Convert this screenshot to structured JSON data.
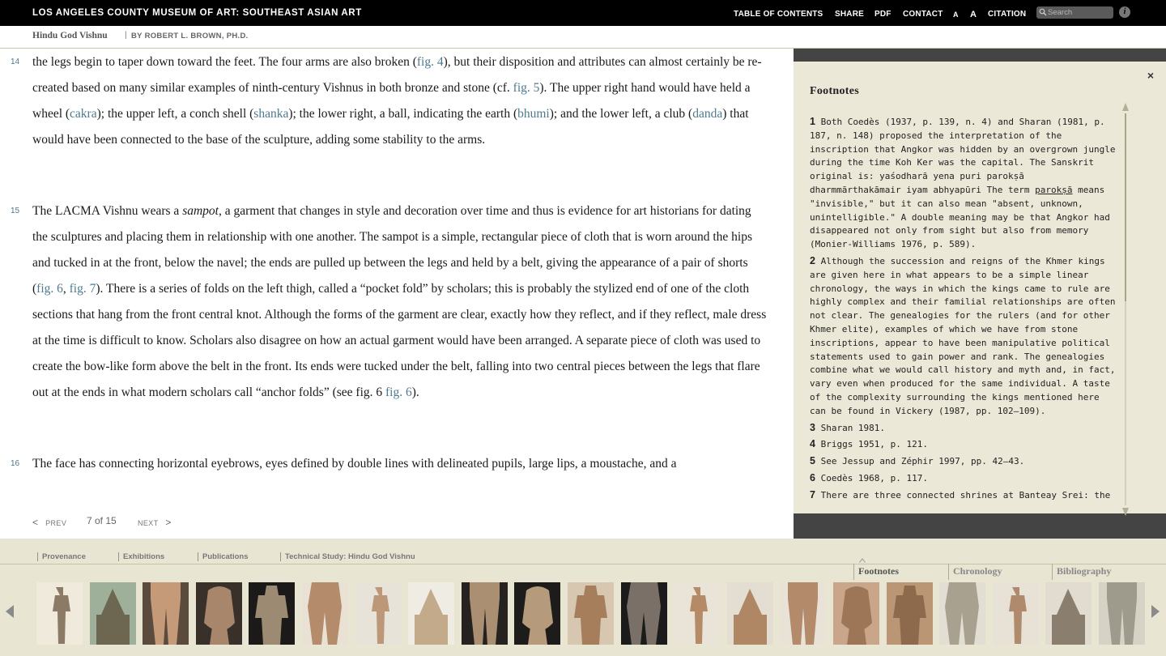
{
  "header": {
    "site_title": "LOS ANGELES COUNTY MUSEUM OF ART: SOUTHEAST ASIAN ART",
    "nav": [
      "TABLE OF CONTENTS",
      "SHARE",
      "PDF",
      "CONTACT",
      "A",
      "A",
      "CITATION"
    ],
    "search_placeholder": "Search",
    "info_label": "i"
  },
  "subheader": {
    "title": "Hindu God Vishnu",
    "separator": "|",
    "author": "BY ROBERT L. BROWN, PH.D."
  },
  "paragraphs": [
    {
      "number": "14",
      "t1": "the legs begin to taper down toward the feet. The four arms are also broken (",
      "a1": "fig. 4",
      "t2": "), but their disposition and attributes can almost certainly be re-created based on many similar examples of ninth-century Vishnus in both bronze and stone (cf. ",
      "a2": "fig. 5",
      "t3": "). The upper right hand would have held a wheel (",
      "a3": "cakra",
      "t4": "); the upper left, a conch shell (",
      "a4": "shanka",
      "t5": "); the lower right, a ball, indicating the earth (",
      "a5": "bhumi",
      "t6": "); and the lower left, a club (",
      "a6": "danda",
      "t7": ") that would have been connected to the base of the sculpture, adding some stability to the arms."
    },
    {
      "number": "15",
      "t1": "The LACMA Vishnu wears a ",
      "em1": "sampot",
      "t2": ", a garment that changes in style and decoration over time and thus is evidence for art historians for dating the sculptures and placing them in relationship with one another. The sampot is a simple, rectangular piece of cloth that is worn around the hips and tucked in at the front, below the navel; the ends are pulled up between the legs and held by a belt, giving the appearance of a pair of shorts (",
      "a1": "fig. 6",
      "t3": ", ",
      "a2": "fig. 7",
      "t4": "). There is a series of folds on the left thigh, called a “pocket fold” by scholars; this is probably the stylized end of one of the cloth sections that hang from the front central knot. Although the forms of the garment are clear, exactly how they reflect, and if they reflect, male dress at the time is difficult to know. Scholars also disagree on how an actual garment would have been arranged. A separate piece of cloth was used to create the bow-like form above the belt in the front. Its ends were tucked under the belt, falling into two central pieces between the legs that flare out at the ends in what modern scholars call “anchor folds” (see fig. 6 ",
      "a3": "fig. 6",
      "t5": ")."
    },
    {
      "number": "16",
      "t1": "The face has connecting horizontal eyebrows, eyes defined by double lines with delineated pupils, large lips, a moustache, and a"
    }
  ],
  "pager": {
    "prev": "PREV",
    "prev_arrow": "<",
    "page": "7 of 15",
    "next": "NEXT",
    "next_arrow": ">"
  },
  "footnotes": {
    "title": "Footnotes",
    "close": "×",
    "items": [
      {
        "n": "1",
        "t1": "Both Coedès (1937, p. 139, n. 4) and Sharan (1981, p. 187, n. 148) proposed the interpretation of the inscription that Angkor was hidden by an overgrown jungle during the time Koh Ker was the capital. The Sanskrit original is: yaśodharā yena puri parokṣā dharmmārthakāmair iyam abhyapūri The term ",
        "u": "parokṣā",
        "t2": " means \"invisible,\" but it can also mean \"absent, unknown, unintelligible.\" A double meaning may be that Angkor had disappeared not only from sight but also from memory (Monier-Williams 1976, p. 589)."
      },
      {
        "n": "2",
        "t1": "Although the succession and reigns of the Khmer kings are given here in what appears to be a simple linear chronology, the ways in which the kings came to rule are highly complex and their familial relationships are often not clear. The genealogies for the rulers (and for other Khmer elite), examples of which we have from stone inscriptions, appear to have been manipulative political statements used to gain power and rank. The genealogies combine what we would call history and myth and, in fact, vary even when produced for the same individual. A taste of the complexity surrounding the kings mentioned here can be found in Vickery (1987, pp. 102–109)."
      },
      {
        "n": "3",
        "t1": "Sharan 1981."
      },
      {
        "n": "4",
        "t1": "Briggs 1951, p. 121."
      },
      {
        "n": "5",
        "t1": "See Jessup and Zéphir 1997, pp. 42–43."
      },
      {
        "n": "6",
        "t1": "Coedès 1968, p. 117."
      },
      {
        "n": "7",
        "t1": "There are three connected shrines at Banteay Srei: the central shrine, which is the largest and dedicated to Shiva, and two smaller shrines on either side."
      }
    ]
  },
  "bottom": {
    "links": [
      "Provenance",
      "Exhibitions",
      "Publications",
      "Technical Study: Hindu God Vishnu"
    ],
    "tabs": [
      "Footnotes",
      "Chronology",
      "Bibliography"
    ],
    "active_tab": "Footnotes"
  },
  "thumbnails": [
    {
      "name": "standing-statue",
      "bg": "#efeadb",
      "fg": "#8a7a66"
    },
    {
      "name": "temple-pyramid",
      "bg": "#9fb09a",
      "fg": "#6d6650"
    },
    {
      "name": "legs-detail",
      "bg": "#5b4a3e",
      "fg": "#c49a78"
    },
    {
      "name": "torso-back",
      "bg": "#3a302a",
      "fg": "#a8866c"
    },
    {
      "name": "four-armed-statue",
      "bg": "#1c1a18",
      "fg": "#9c8a72"
    },
    {
      "name": "sampot-detail",
      "bg": "#e9e2d4",
      "fg": "#b48c6c"
    },
    {
      "name": "hips-detail",
      "bg": "#e8e3d8",
      "fg": "#bc9778"
    },
    {
      "name": "face-crown",
      "bg": "#efece4",
      "fg": "#c3aa8a"
    },
    {
      "name": "crowned-head",
      "bg": "#252220",
      "fg": "#ab8f72"
    },
    {
      "name": "head-back",
      "bg": "#1e1c1a",
      "fg": "#b69a7c"
    },
    {
      "name": "folds-detail",
      "bg": "#d7c6b0",
      "fg": "#a77e5c"
    },
    {
      "name": "small-figure",
      "bg": "#1b1b1b",
      "fg": "#7a7068"
    },
    {
      "name": "torso-front",
      "bg": "#eae4d8",
      "fg": "#b58a66"
    },
    {
      "name": "torso-side",
      "bg": "#e3ddd2",
      "fg": "#b08764"
    },
    {
      "name": "torso-three-quarter",
      "bg": "#e8e2d7",
      "fg": "#b38a6a"
    },
    {
      "name": "belt-closeup",
      "bg": "#c9a689",
      "fg": "#9c7656"
    },
    {
      "name": "anchor-folds",
      "bg": "#bb9675",
      "fg": "#8e6a4c"
    },
    {
      "name": "gray-torso",
      "bg": "#e3ded4",
      "fg": "#a9a190"
    },
    {
      "name": "weathered-torso",
      "bg": "#e7e1d6",
      "fg": "#b08a6c"
    },
    {
      "name": "dark-torso",
      "bg": "#e1dbd0",
      "fg": "#8a7f6e"
    },
    {
      "name": "gray-legs",
      "bg": "#d6d2c6",
      "fg": "#9e9a8c"
    }
  ],
  "colors": {
    "link": "#4b7a8e",
    "panel_bg": "#ece8d8",
    "bottom_bg": "#e9e5d3",
    "dark_panel": "#444444"
  }
}
